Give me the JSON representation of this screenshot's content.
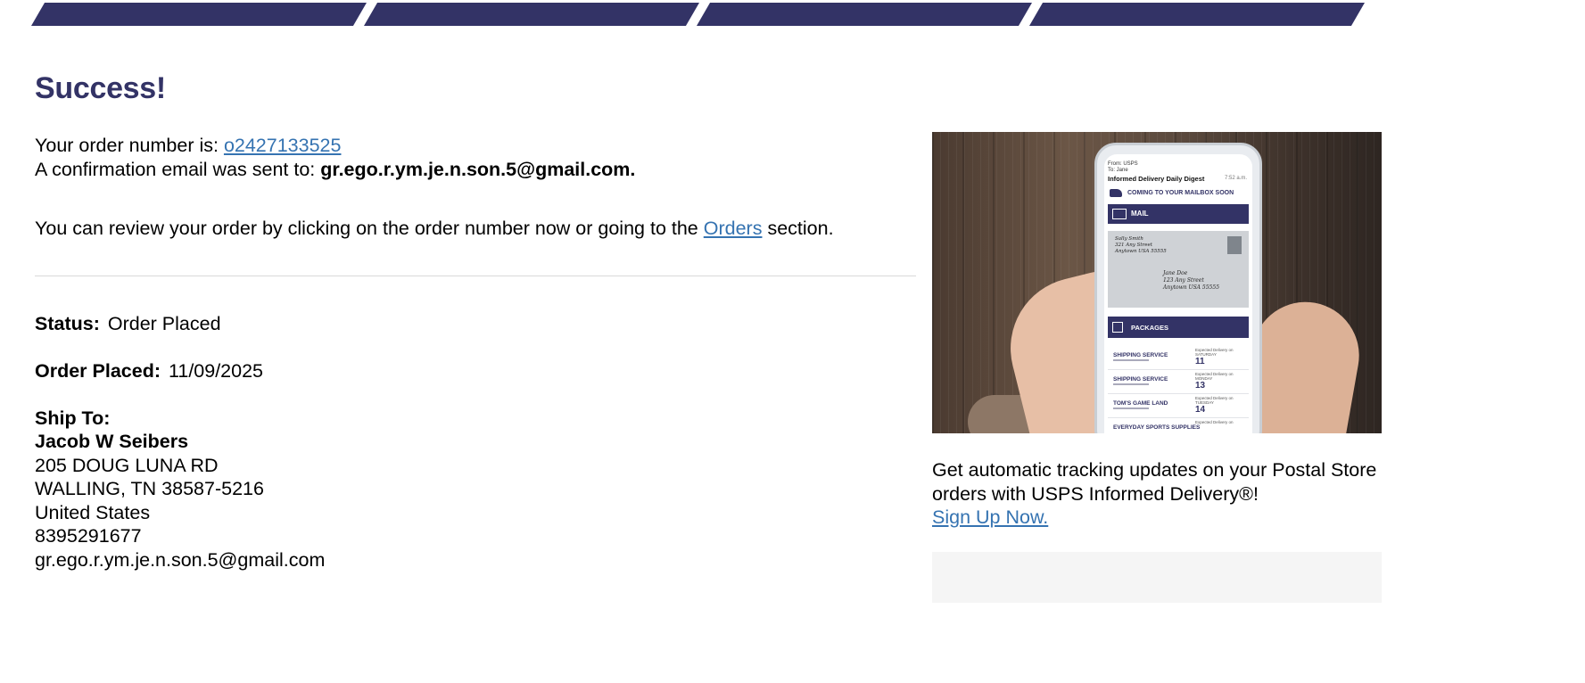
{
  "progress": {
    "step_count": 4,
    "color": "#333366"
  },
  "heading": "Success!",
  "order": {
    "number_prefix": "Your order number is: ",
    "number": "o2427133525",
    "email_prefix": "A confirmation email was sent to: ",
    "email": "gr.ego.r.ym.je.n.son.5@gmail.com.",
    "review_prefix": "You can review your order by clicking on the order number now or going to the ",
    "orders_link": "Orders",
    "review_suffix": " section."
  },
  "details": {
    "status_label": "Status:",
    "status_value": "Order Placed",
    "placed_label": "Order Placed:",
    "placed_value": "11/09/2025",
    "ship_to_label": "Ship To:",
    "name": "Jacob W Seibers",
    "address_line1": "205 DOUG LUNA RD",
    "address_line2": "WALLING, TN 38587-5216",
    "country": "United States",
    "phone": "8395291677",
    "email": "gr.ego.r.ym.je.n.son.5@gmail.com"
  },
  "promo": {
    "image": {
      "from": "From: USPS",
      "to": "To: Jane",
      "title": "Informed Delivery Daily Digest",
      "time": "7:52 a.m.",
      "coming": "COMING TO YOUR MAILBOX SOON",
      "mail_header": "MAIL",
      "return_addr": [
        "Sally Smith",
        "321 Any Street",
        "Anytown USA 55555"
      ],
      "dest_addr": [
        "Jane Doe",
        "123 Any Street",
        "Anytown USA 55555"
      ],
      "packages_header": "PACKAGES",
      "packages": [
        {
          "name": "SHIPPING SERVICE",
          "day": "Expected Delivery on SATURDAY",
          "date": "11"
        },
        {
          "name": "SHIPPING SERVICE",
          "day": "Expected Delivery on MONDAY",
          "date": "13"
        },
        {
          "name": "TOM'S GAME LAND",
          "day": "Expected Delivery on TUESDAY",
          "date": "14"
        },
        {
          "name": "EVERYDAY SPORTS SUPPLIES",
          "day": "Expected Delivery on",
          "date": ""
        }
      ]
    },
    "text": "Get automatic tracking updates on your Postal Store orders with USPS Informed Delivery®!",
    "link": "Sign Up Now."
  }
}
